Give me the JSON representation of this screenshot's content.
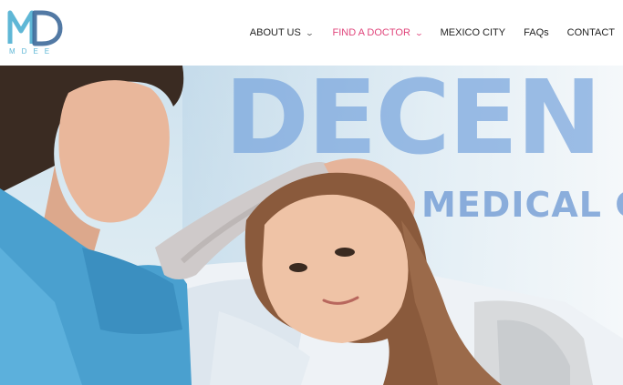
{
  "brand": {
    "logo_letters": "MD",
    "logo_text": "MDEE",
    "colors": {
      "teal": "#5fb7d6",
      "navy": "#3f6a9a"
    }
  },
  "nav": {
    "items": [
      {
        "label": "ABOUT US",
        "has_dropdown": true,
        "active": false
      },
      {
        "label": "FIND A DOCTOR",
        "has_dropdown": true,
        "active": true
      },
      {
        "label": "MEXICO CITY",
        "has_dropdown": false,
        "active": false
      },
      {
        "label": "FAQs",
        "has_dropdown": false,
        "active": false
      },
      {
        "label": "CONTACT",
        "has_dropdown": false,
        "active": false
      }
    ],
    "active_color": "#e0457b"
  },
  "hero": {
    "title": "DECEN",
    "subtitle": "MEDICAL C",
    "image": "nurse comforting a girl lying in a hospital bed"
  }
}
